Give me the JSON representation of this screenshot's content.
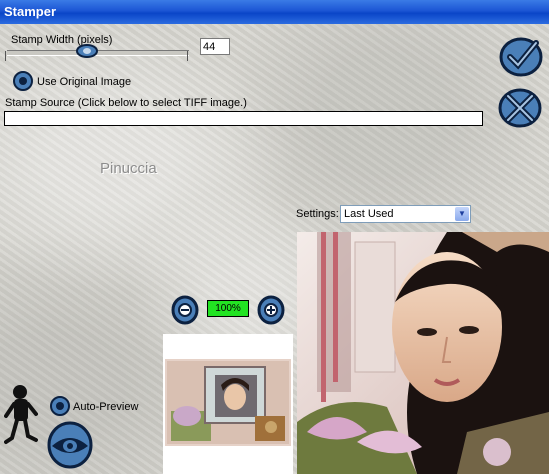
{
  "window": {
    "title": "Stamper"
  },
  "stamp_width": {
    "label": "Stamp Width (pixels)",
    "value": "44",
    "level_fraction": 0.44
  },
  "use_original": {
    "label": "Use Original Image"
  },
  "stamp_source": {
    "label": "Stamp Source (Click below to select TIFF image.)",
    "value": ""
  },
  "watermark": "Pinuccia",
  "settings": {
    "label": "Settings:",
    "selected": "Last Used"
  },
  "zoom": {
    "value": "100%"
  },
  "auto_preview": {
    "label": "Auto-Preview"
  },
  "colors": {
    "accent": "#0a45c8",
    "zoom_bg": "#22e322",
    "button_blue": "#4a7fb8"
  }
}
